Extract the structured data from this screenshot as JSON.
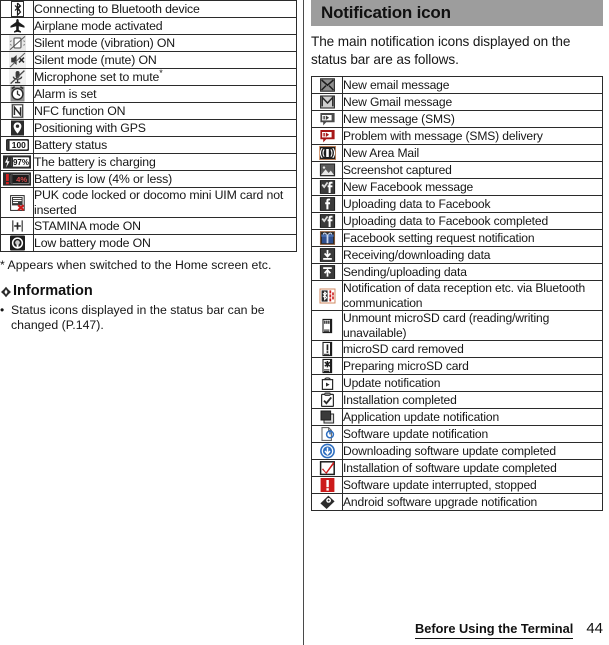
{
  "page": {
    "number": "44",
    "running_head": "Before Using the Terminal"
  },
  "left_column": {
    "status_table": {
      "rows": [
        {
          "icon": "bluetooth-connecting-icon",
          "desc": "Connecting to Bluetooth device"
        },
        {
          "icon": "airplane-mode-icon",
          "desc": "Airplane mode activated"
        },
        {
          "icon": "silent-vibration-icon",
          "desc": "Silent mode (vibration) ON"
        },
        {
          "icon": "silent-mute-icon",
          "desc": "Silent mode (mute) ON"
        },
        {
          "icon": "microphone-mute-icon",
          "desc": "Microphone set to mute",
          "superscript": "*"
        },
        {
          "icon": "alarm-set-icon",
          "desc": "Alarm is set"
        },
        {
          "icon": "nfc-on-icon",
          "desc": "NFC function ON"
        },
        {
          "icon": "gps-positioning-icon",
          "desc": "Positioning with GPS"
        },
        {
          "icon": "battery-status-icon",
          "desc": "Battery status",
          "icon_label": "100"
        },
        {
          "icon": "battery-charging-icon",
          "desc": "The battery is charging",
          "icon_label": "97%"
        },
        {
          "icon": "battery-low-icon",
          "desc": "Battery is low (4% or less)",
          "icon_label": "4%"
        },
        {
          "icon": "puk-locked-sim-icon",
          "desc": "PUK code locked or docomo mini UIM card not inserted"
        },
        {
          "icon": "stamina-mode-icon",
          "desc": "STAMINA mode ON"
        },
        {
          "icon": "low-battery-mode-icon",
          "desc": "Low battery mode ON"
        }
      ]
    },
    "footnote": "*  Appears when switched to the Home screen etc.",
    "information": {
      "heading": "Information",
      "bullet_symbol": "•",
      "items": [
        "Status icons displayed in the status bar can be changed (P.147)."
      ]
    }
  },
  "right_column": {
    "section_title": "Notification icon",
    "intro": "The main notification icons displayed on the status bar are as follows.",
    "notification_table": {
      "rows": [
        {
          "icon": "new-email-icon",
          "desc": "New email message"
        },
        {
          "icon": "new-gmail-icon",
          "desc": "New Gmail message"
        },
        {
          "icon": "new-sms-icon",
          "desc": "New message (SMS)"
        },
        {
          "icon": "sms-delivery-problem-icon",
          "desc": "Problem with message (SMS) delivery"
        },
        {
          "icon": "new-area-mail-icon",
          "desc": "New Area Mail"
        },
        {
          "icon": "screenshot-captured-icon",
          "desc": "Screenshot captured"
        },
        {
          "icon": "new-facebook-message-icon",
          "desc": "New Facebook message"
        },
        {
          "icon": "facebook-uploading-icon",
          "desc": "Uploading data to Facebook"
        },
        {
          "icon": "facebook-upload-complete-icon",
          "desc": "Uploading data to Facebook completed"
        },
        {
          "icon": "facebook-setting-request-icon",
          "desc": "Facebook setting request notification"
        },
        {
          "icon": "downloading-data-icon",
          "desc": "Receiving/downloading data"
        },
        {
          "icon": "uploading-data-icon",
          "desc": "Sending/uploading data"
        },
        {
          "icon": "bluetooth-reception-icon",
          "desc": "Notification of data reception etc. via Bluetooth communication"
        },
        {
          "icon": "microsd-unmount-icon",
          "desc": "Unmount microSD card (reading/writing unavailable)"
        },
        {
          "icon": "microsd-removed-icon",
          "desc": "microSD card removed"
        },
        {
          "icon": "microsd-preparing-icon",
          "desc": "Preparing microSD card"
        },
        {
          "icon": "update-notification-icon",
          "desc": "Update notification"
        },
        {
          "icon": "installation-completed-icon",
          "desc": "Installation completed"
        },
        {
          "icon": "application-update-icon",
          "desc": "Application update notification"
        },
        {
          "icon": "software-update-notification-icon",
          "desc": "Software update notification"
        },
        {
          "icon": "software-download-complete-icon",
          "desc": "Downloading software update completed"
        },
        {
          "icon": "software-install-complete-icon",
          "desc": "Installation of software update completed"
        },
        {
          "icon": "software-update-stopped-icon",
          "desc": "Software update interrupted, stopped"
        },
        {
          "icon": "android-upgrade-icon",
          "desc": "Android software upgrade notification"
        }
      ]
    }
  },
  "colors": {
    "band_background": "#9d9d9d",
    "rule": "#2b2b2b",
    "text": "#171717",
    "alert_red": "#cc1a1a",
    "bluetooth_blue": "#1e7fd4"
  }
}
